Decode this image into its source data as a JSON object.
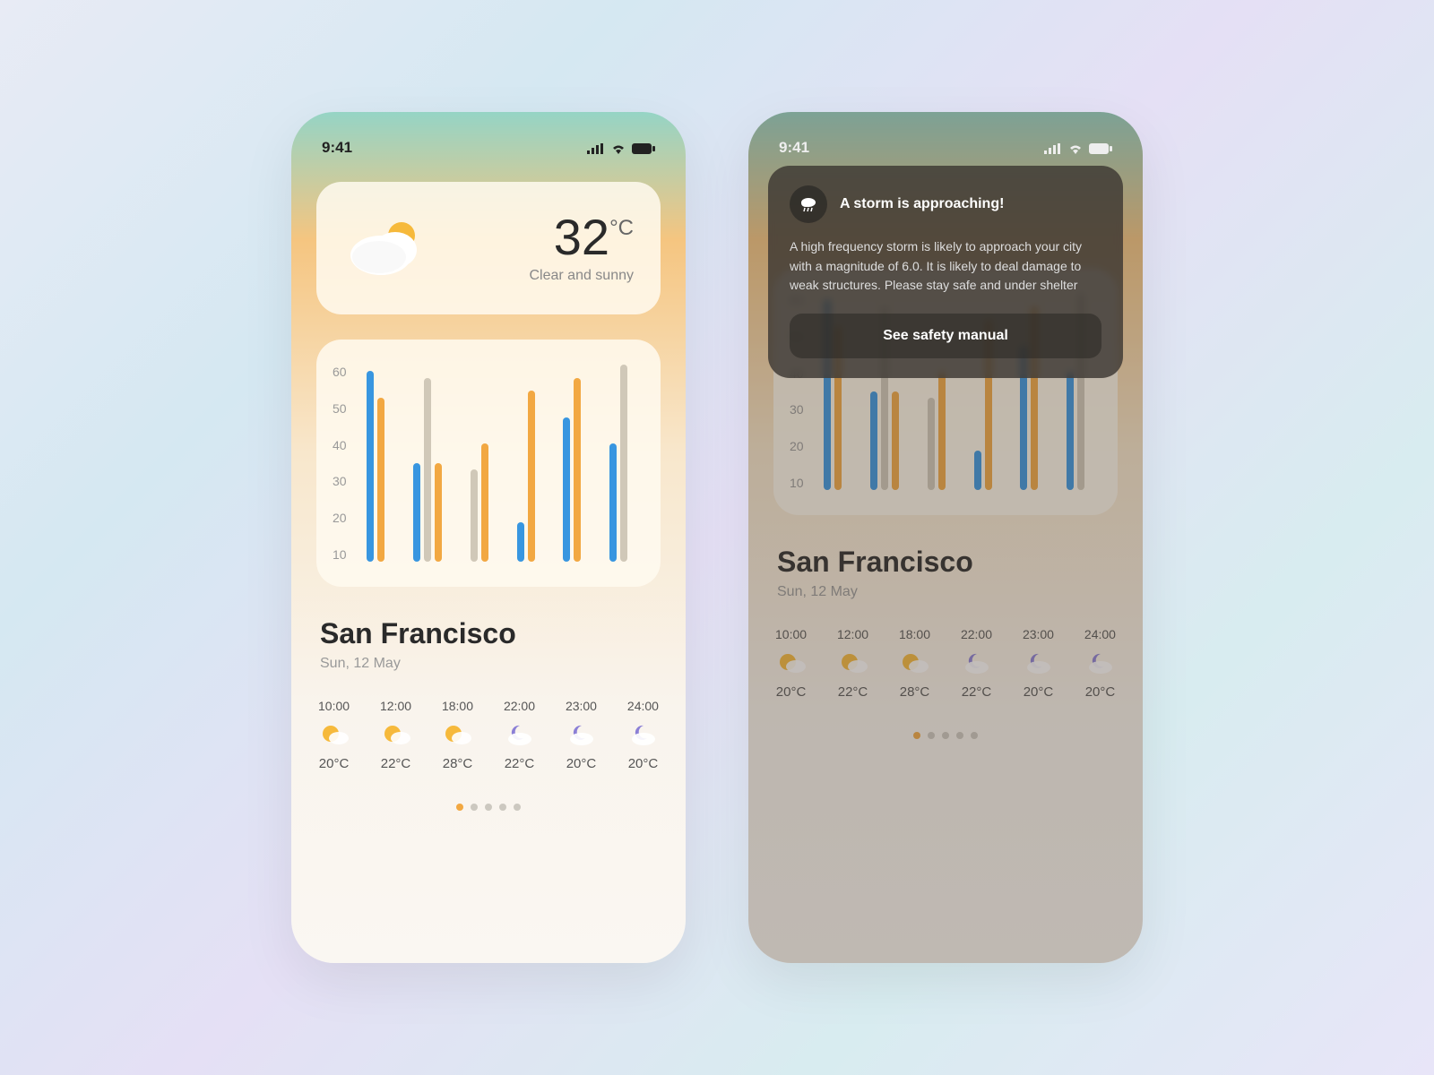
{
  "status": {
    "time": "9:41"
  },
  "current": {
    "temp_value": "32",
    "temp_unit": "°C",
    "description": "Clear and sunny"
  },
  "chart_data": {
    "type": "bar",
    "y_ticks": [
      "60",
      "50",
      "40",
      "30",
      "20",
      "10"
    ],
    "ylim": [
      0,
      60
    ],
    "series_names": [
      "blue",
      "gray",
      "orange"
    ],
    "categories": [
      "10:00",
      "12:00",
      "18:00",
      "22:00",
      "23:00",
      "24:00"
    ],
    "groups": [
      {
        "blue": 58,
        "gray": null,
        "orange": 50
      },
      {
        "blue": 30,
        "gray": 56,
        "orange": 30
      },
      {
        "blue": null,
        "gray": 28,
        "orange": 36
      },
      {
        "blue": 12,
        "gray": null,
        "orange": 52
      },
      {
        "blue": 44,
        "gray": null,
        "orange": 56
      },
      {
        "blue": 36,
        "gray": 60,
        "orange": null
      }
    ]
  },
  "location": {
    "city": "San Francisco",
    "date": "Sun, 12 May"
  },
  "hourly": [
    {
      "time": "10:00",
      "icon": "sun",
      "temp": "20°C"
    },
    {
      "time": "12:00",
      "icon": "sun",
      "temp": "22°C"
    },
    {
      "time": "18:00",
      "icon": "sun",
      "temp": "28°C"
    },
    {
      "time": "22:00",
      "icon": "moon",
      "temp": "22°C"
    },
    {
      "time": "23:00",
      "icon": "moon",
      "temp": "20°C"
    },
    {
      "time": "24:00",
      "icon": "moon",
      "temp": "20°C"
    }
  ],
  "pagination": {
    "count": 5,
    "active": 0
  },
  "alert": {
    "title": "A storm is approaching!",
    "body": "A high frequency storm is likely to approach your city with a magnitude of 6.0. It is likely to deal damage to weak structures. Please stay safe and under shelter",
    "button": "See safety manual"
  },
  "colors": {
    "blue": "#3896e0",
    "orange": "#f2a842",
    "gray": "#d0c8b8"
  }
}
